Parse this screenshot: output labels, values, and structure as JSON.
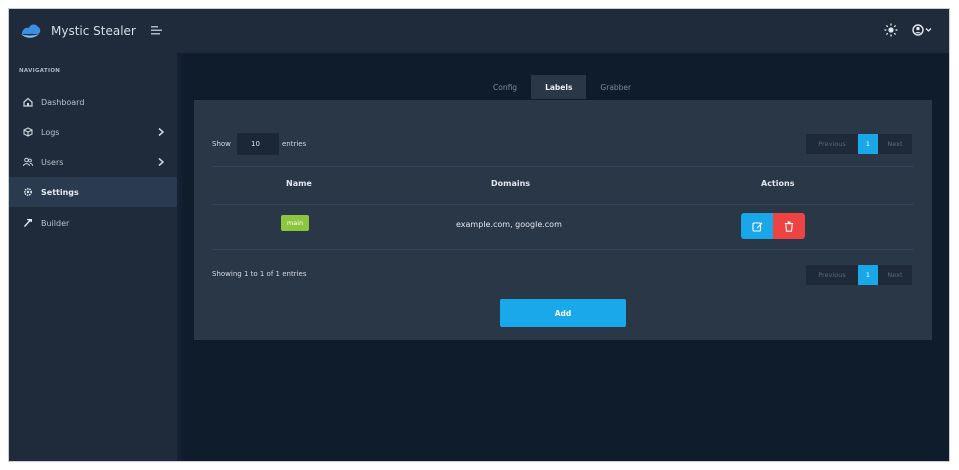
{
  "app": {
    "name": "Mystic Stealer"
  },
  "colors": {
    "accent": "#1aa7e8",
    "danger": "#ee4343",
    "badge": "#8cc63f",
    "sidebar": "#1f2b3a",
    "background": "#0f1c2c"
  },
  "sidebar": {
    "section_title": "NAVIGATION",
    "items": [
      {
        "label": "Dashboard",
        "icon": "home-icon",
        "has_submenu": false,
        "active": false
      },
      {
        "label": "Logs",
        "icon": "cube-icon",
        "has_submenu": true,
        "active": false
      },
      {
        "label": "Users",
        "icon": "users-icon",
        "has_submenu": true,
        "active": false
      },
      {
        "label": "Settings",
        "icon": "gear-icon",
        "has_submenu": false,
        "active": true
      },
      {
        "label": "Builder",
        "icon": "hammer-icon",
        "has_submenu": false,
        "active": false
      }
    ]
  },
  "topbar": {
    "icons": [
      "theme-sun-icon",
      "user-account-icon"
    ]
  },
  "tabs": [
    {
      "label": "Config",
      "active": false
    },
    {
      "label": "Labels",
      "active": true
    },
    {
      "label": "Grabber",
      "active": false
    }
  ],
  "table": {
    "show_label": "Show",
    "page_size": "10",
    "entries_label": "entries",
    "columns": [
      "Name",
      "Domains",
      "Actions"
    ],
    "rows": [
      {
        "name": "main",
        "domains": "example.com, google.com"
      }
    ],
    "summary": "Showing 1 to 1 of 1 entries",
    "pagination": {
      "previous": "Previous",
      "current": "1",
      "next": "Next"
    }
  },
  "add_button": "Add"
}
